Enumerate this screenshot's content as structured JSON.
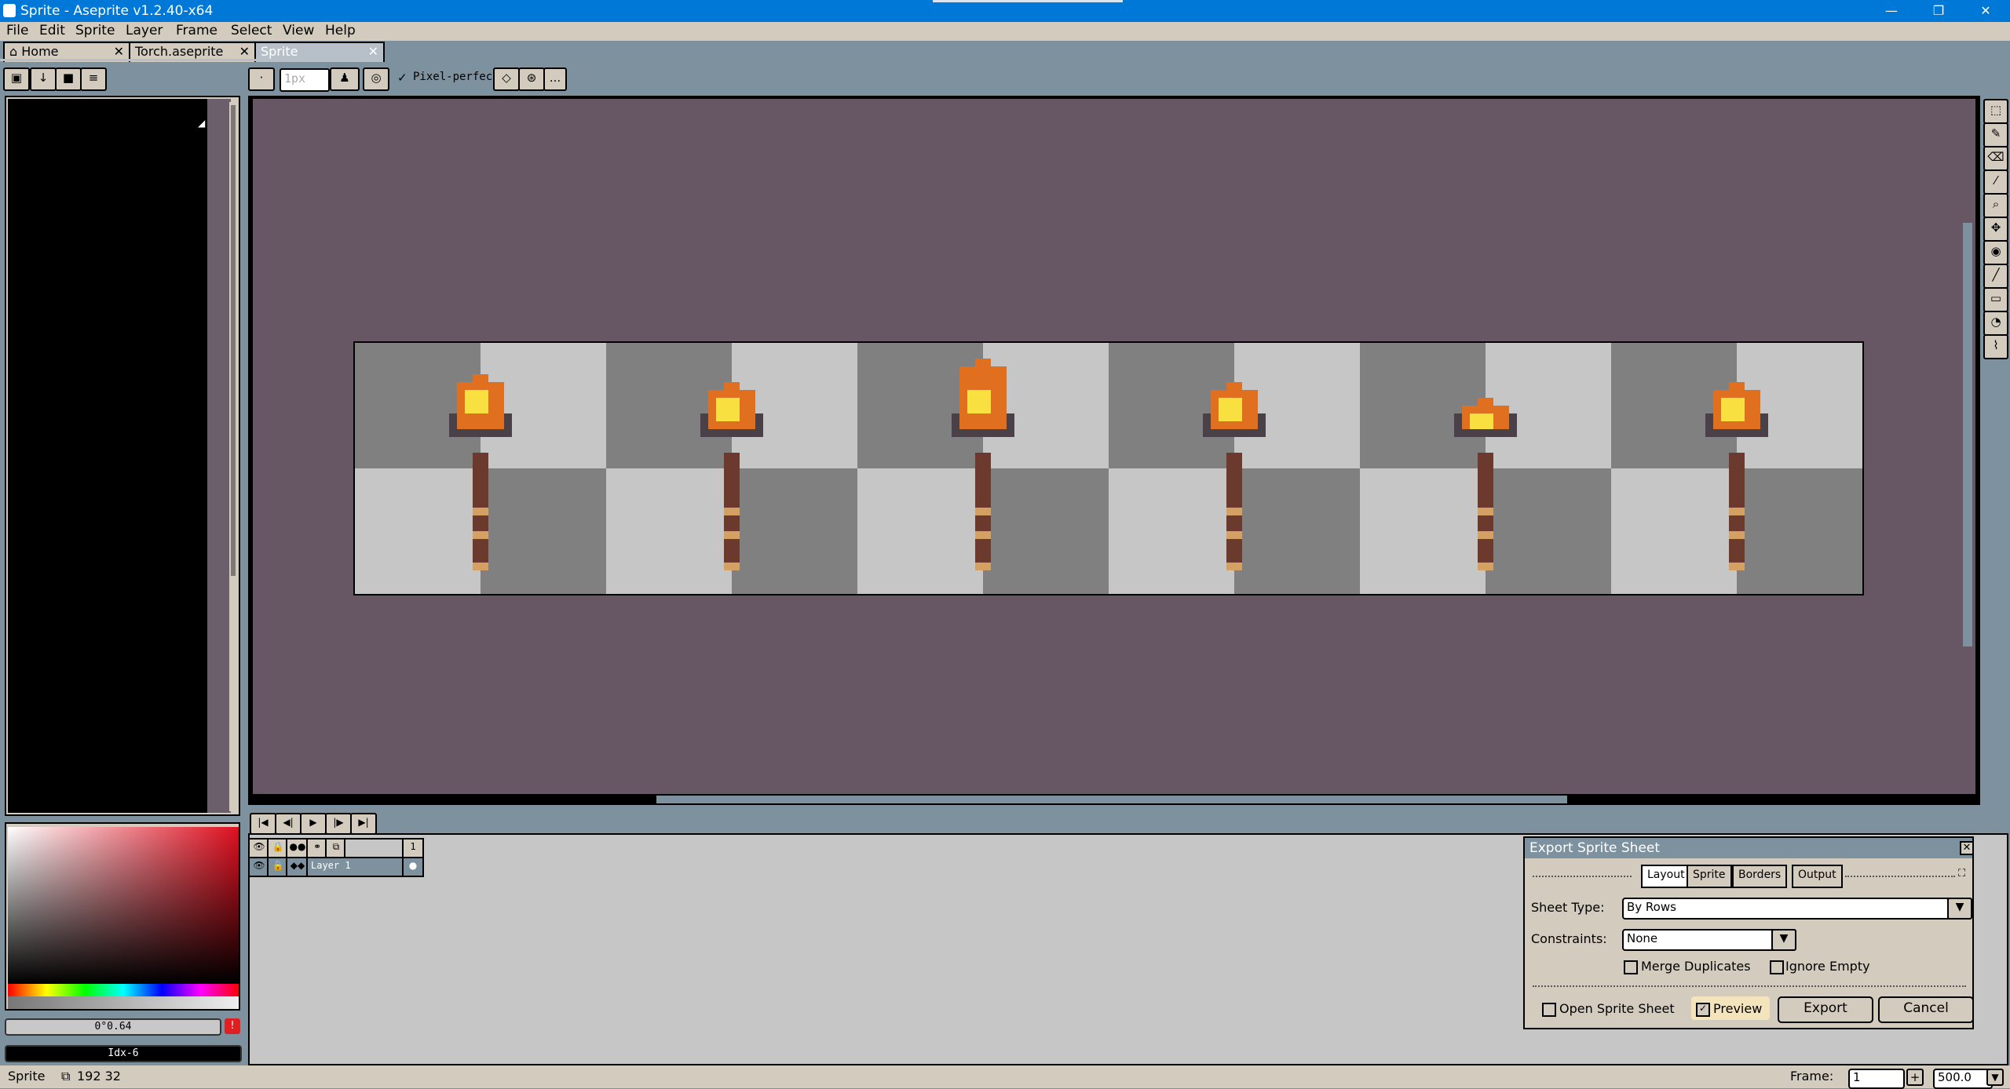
{
  "window": {
    "title": "Sprite - Aseprite v1.2.40-x64",
    "controls": {
      "minimize": "—",
      "maximize": "❐",
      "close": "✕"
    }
  },
  "menu": [
    "File",
    "Edit",
    "Sprite",
    "Layer",
    "Frame",
    "Select",
    "View",
    "Help"
  ],
  "tabs": [
    {
      "label": "Home",
      "close": "✕"
    },
    {
      "label": "Torch.aseprite",
      "close": "✕"
    },
    {
      "label": "Sprite",
      "close": "✕"
    }
  ],
  "toolbar": {
    "brush_size": "1px",
    "pixel_perfect": "Pixel-perfect",
    "more": "..."
  },
  "color": {
    "value": "0°0.64",
    "index": "Idx-6",
    "warning": "!"
  },
  "timeline": {
    "frame_header": "1",
    "layer_name": "Layer 1"
  },
  "dialog": {
    "title": "Export Sprite Sheet",
    "tabs": [
      "Layout",
      "Sprite",
      "Borders",
      "Output"
    ],
    "sheet_type_label": "Sheet Type:",
    "sheet_type_value": "By Rows",
    "constraints_label": "Constraints:",
    "constraints_value": "None",
    "merge_duplicates": "Merge Duplicates",
    "ignore_empty": "Ignore Empty",
    "open_sprite_sheet": "Open Sprite Sheet",
    "preview": "Preview",
    "export": "Export",
    "cancel": "Cancel"
  },
  "status": {
    "sprite": "Sprite",
    "size": "192 32",
    "frame_label": "Frame:",
    "frame_value": "1",
    "zoom": "500.0"
  },
  "sprite_sheet": {
    "frames": 6,
    "frame_size": [
      32,
      32
    ],
    "flame_heights": [
      6,
      5,
      8,
      5,
      3,
      5
    ]
  },
  "colors": {
    "ui_panel": "#d3cbbe",
    "ui_bg": "#7d929e",
    "canvas_bg": "#675663",
    "checker_dark": "#808080",
    "checker_light": "#c6c6c6",
    "titlebar": "#0078d7",
    "flame_orange": "#e07020",
    "flame_yellow": "#f8e040",
    "stick_brown": "#6b3a2c",
    "band_tan": "#d4a064",
    "head_dark": "#4a4048"
  }
}
